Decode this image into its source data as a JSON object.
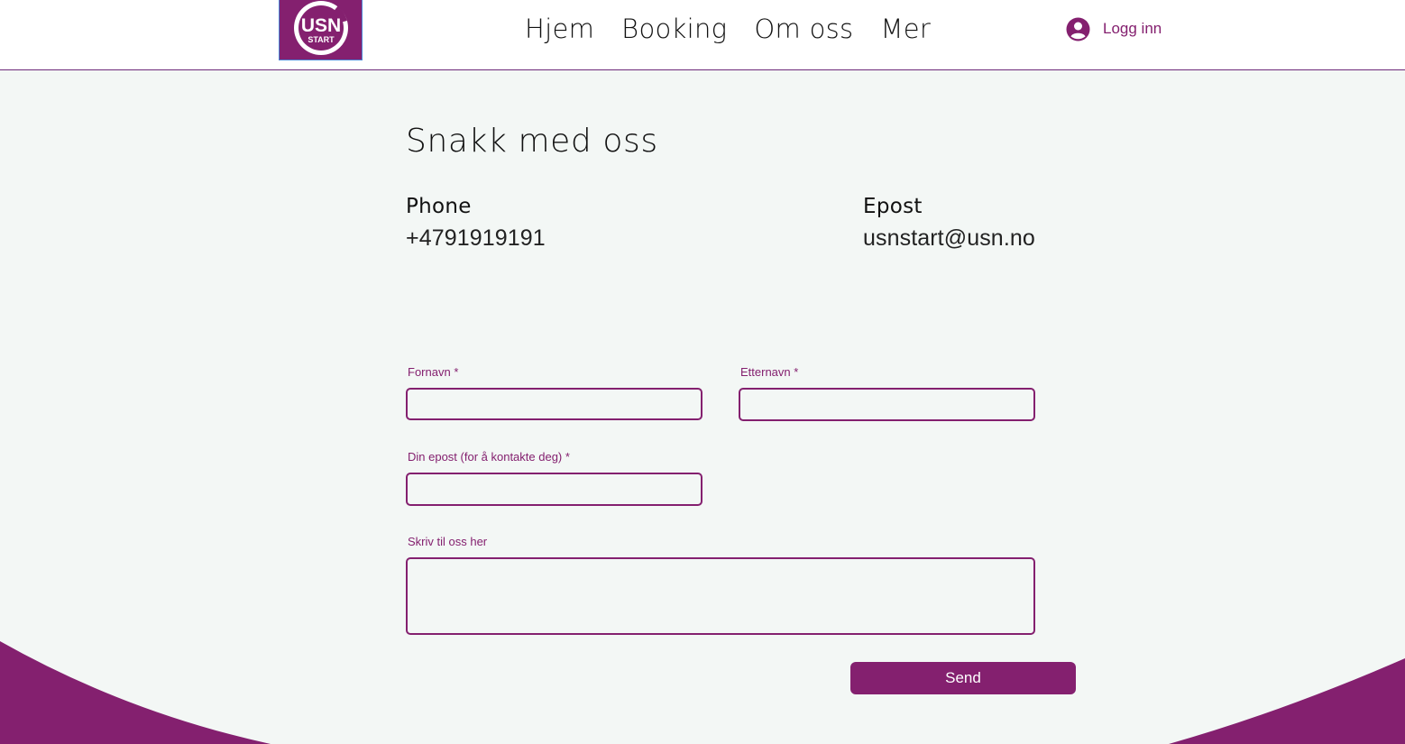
{
  "brand": {
    "logo_text": "USN",
    "logo_subtext": "START",
    "accent_color": "#84206f"
  },
  "nav": {
    "items": [
      {
        "label": "Hjem"
      },
      {
        "label": "Booking"
      },
      {
        "label": "Om oss"
      },
      {
        "label": "Mer"
      }
    ],
    "login_label": "Logg inn",
    "login_icon": "user-avatar-icon"
  },
  "contact": {
    "title": "Snakk med oss",
    "phone_label": "Phone",
    "phone_value": "+4791919191",
    "email_label": "Epost",
    "email_value": "usnstart@usn.no"
  },
  "form": {
    "first_name_label": "Fornavn",
    "last_name_label": "Etternavn",
    "email_label": "Din epost (for å kontakte deg)",
    "message_label": "Skriv til oss her",
    "required_mark": "*",
    "first_name_value": "",
    "last_name_value": "",
    "email_value": "",
    "message_value": "",
    "send_label": "Send"
  }
}
